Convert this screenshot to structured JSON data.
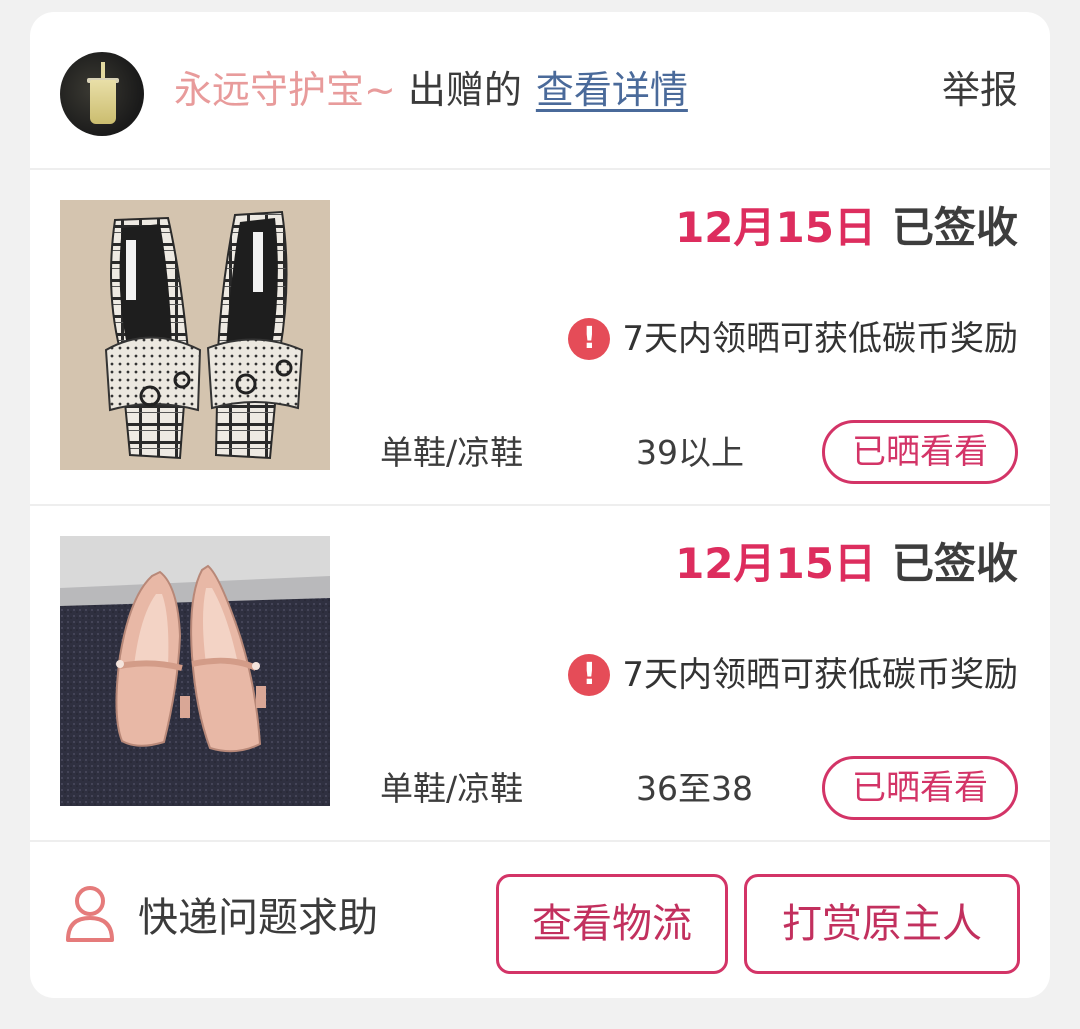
{
  "header": {
    "username": "永远守护宝~",
    "gave_text": "出赠的",
    "detail_link": "查看详情",
    "report_label": "举报"
  },
  "items": [
    {
      "date": "12月15日",
      "status": "已签收",
      "tip": "7天内领晒可获低碳币奖励",
      "category": "单鞋/凉鞋",
      "size": "39以上",
      "button": "已晒看看"
    },
    {
      "date": "12月15日",
      "status": "已签收",
      "tip": "7天内领晒可获低碳币奖励",
      "category": "单鞋/凉鞋",
      "size": "36至38",
      "button": "已晒看看"
    }
  ],
  "footer": {
    "help_label": "快递问题求助",
    "logistics_button": "查看物流",
    "reward_button": "打赏原主人"
  },
  "colors": {
    "accent": "#dd2d5e",
    "username": "#e89b9b",
    "link": "#4a6a9a",
    "warn": "#e54c58"
  }
}
